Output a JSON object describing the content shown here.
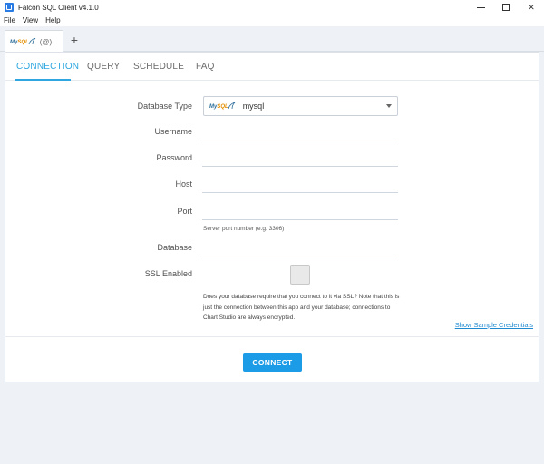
{
  "window": {
    "title": "Falcon SQL Client v4.1.0",
    "minimize": "–",
    "maximize": "□",
    "close": "✕"
  },
  "menu": [
    "File",
    "View",
    "Help"
  ],
  "tabs": {
    "connection_tab_label": "(@)",
    "add_tab": "+"
  },
  "nav": [
    "CONNECTION",
    "QUERY",
    "SCHEDULE",
    "FAQ"
  ],
  "logo": {
    "my": "My",
    "sql": "SQL"
  },
  "form": {
    "database_type_label": "Database Type",
    "database_type_value": "mysql",
    "username_label": "Username",
    "password_label": "Password",
    "host_label": "Host",
    "port_label": "Port",
    "port_hint": "Server port number (e.g. 3306)",
    "database_label": "Database",
    "ssl_label": "SSL Enabled",
    "ssl_note": "Does your database require that you connect to it via SSL? Note that this is just the connection between this app and your database; connections to Chart Studio are always encrypted.",
    "sample_link": "Show Sample Credentials",
    "connect_button": "CONNECT"
  },
  "colors": {
    "accent": "#2ea7e0",
    "button": "#1c9be6"
  }
}
